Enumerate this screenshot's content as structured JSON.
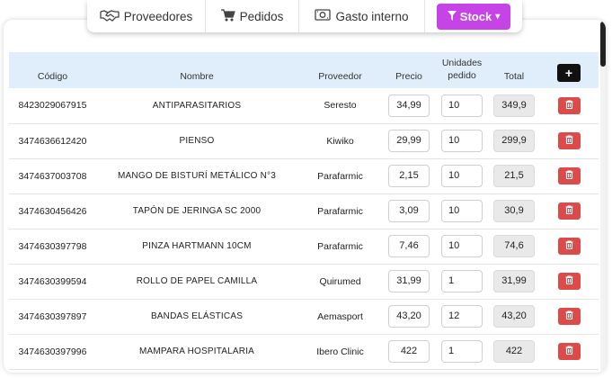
{
  "tabs": {
    "proveedores": "Proveedores",
    "pedidos": "Pedidos",
    "gasto": "Gasto interno",
    "stock": "Stock",
    "stock_caret": "▾"
  },
  "table": {
    "headers": {
      "codigo": "Código",
      "nombre": "Nombre",
      "proveedor": "Proveedor",
      "precio": "Precio",
      "unidades_1": "Unidades",
      "unidades_2": "pedido",
      "total": "Total"
    },
    "add_label": "+",
    "rows": [
      {
        "codigo": "8423029067915",
        "nombre": "ANTIPARASITARIOS",
        "proveedor": "Seresto",
        "precio": "34,99",
        "unidades": "10",
        "total": "349,9"
      },
      {
        "codigo": "3474636612420",
        "nombre": "PIENSO",
        "proveedor": "Kiwiko",
        "precio": "29,99",
        "unidades": "10",
        "total": "299,9"
      },
      {
        "codigo": "3474637003708",
        "nombre": "MANGO DE BISTURÍ METÁLICO N°3",
        "proveedor": "Parafarmic",
        "precio": "2,15",
        "unidades": "10",
        "total": "21,5"
      },
      {
        "codigo": "3474630456426",
        "nombre": "TAPÓN DE JERINGA SC 2000",
        "proveedor": "Parafarmic",
        "precio": "3,09",
        "unidades": "10",
        "total": "30,9"
      },
      {
        "codigo": "3474630397798",
        "nombre": "PINZA HARTMANN 10CM",
        "proveedor": "Parafarmic",
        "precio": "7,46",
        "unidades": "10",
        "total": "74,6"
      },
      {
        "codigo": "3474630399594",
        "nombre": "ROLLO DE PAPEL CAMILLA",
        "proveedor": "Quirumed",
        "precio": "31,99",
        "unidades": "1",
        "total": "31,99"
      },
      {
        "codigo": "3474630397897",
        "nombre": "BANDAS ELÁSTICAS",
        "proveedor": "Aemasport",
        "precio": "43,20",
        "unidades": "12",
        "total": "43,20"
      },
      {
        "codigo": "3474630397996",
        "nombre": "MAMPARA HOSPITALARIA",
        "proveedor": "Ibero Clinic",
        "precio": "422",
        "unidades": "1",
        "total": "422"
      }
    ]
  },
  "colors": {
    "accent": "#c643e6",
    "header_bg": "#dfeefa",
    "delete": "#dc4a4a",
    "add": "#111111"
  },
  "icons": {
    "proveedores": "handshake-icon",
    "pedidos": "cart-icon",
    "gasto": "banknote-icon",
    "stock": "filter-icon",
    "delete": "trash-icon",
    "add": "plus-icon"
  }
}
